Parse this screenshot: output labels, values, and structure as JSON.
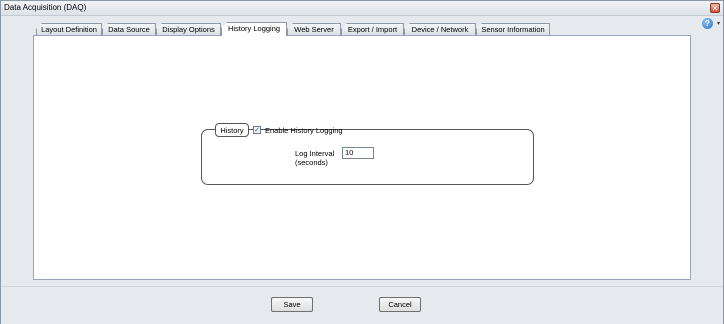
{
  "window": {
    "title": "Data Acquisition (DAQ)",
    "close_glyph": "✕",
    "help_glyph": "?",
    "help_caret": "▾"
  },
  "tabs": [
    {
      "label": "Layout Definition",
      "active": false
    },
    {
      "label": "Data Source",
      "active": false
    },
    {
      "label": "Display Options",
      "active": false
    },
    {
      "label": "History Logging",
      "active": true
    },
    {
      "label": "Web Server",
      "active": false
    },
    {
      "label": "Export / Import",
      "active": false
    },
    {
      "label": "Device / Network",
      "active": false
    },
    {
      "label": "Sensor Information",
      "active": false
    }
  ],
  "history": {
    "group_label": "History",
    "enable_label": "Enable History Logging",
    "enabled": true,
    "check_glyph": "✓",
    "interval_label_line1": "Log Interval",
    "interval_label_line2": "(seconds)",
    "interval_value": "10"
  },
  "buttons": {
    "save": "Save",
    "cancel": "Cancel"
  }
}
